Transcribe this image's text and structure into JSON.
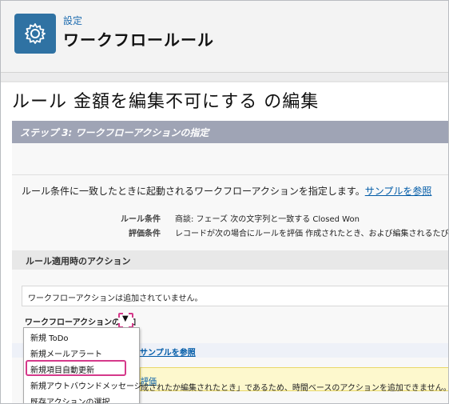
{
  "header": {
    "eyebrow": "設定",
    "title": "ワークフロールール"
  },
  "page": {
    "title": "ルール 金額を編集不可にする の編集",
    "step_title": "ステップ 3: ワークフローアクションの指定",
    "description_text": "ルール条件に一致したときに起動されるワークフローアクションを指定します。",
    "description_link": "サンプルを参照",
    "rule_condition_label": "ルール条件",
    "rule_condition_value": "商談: フェーズ 次の文字列と一致する Closed Won",
    "eval_condition_label": "評価条件",
    "eval_condition_value": "レコードが次の場合にルールを評価 作成されたとき、および編集されるたび"
  },
  "actions": {
    "section_title": "ルール適用時のアクション",
    "empty_text": "ワークフローアクションは追加されていません。",
    "add_button_label": "ワークフローアクションの追加",
    "dropdown_arrow": "▼"
  },
  "lower": {
    "sample_link": "サンプルを参照",
    "warning_text": "成されたか編集されたとき」であるため、時間ベースのアクションを追加できません。",
    "warning_link": "評価"
  },
  "menu": {
    "items": [
      {
        "label": "新規 ToDo"
      },
      {
        "label": "新規メールアラート"
      },
      {
        "label": "新規項目自動更新"
      },
      {
        "label": "新規アウトバウンドメッセージ"
      },
      {
        "label": "既存アクションの選択"
      }
    ],
    "highlighted_item": "新規項目自動更新"
  },
  "colors": {
    "accent": "#2f72a3",
    "highlight": "#d5398a",
    "link": "#015ba7"
  }
}
